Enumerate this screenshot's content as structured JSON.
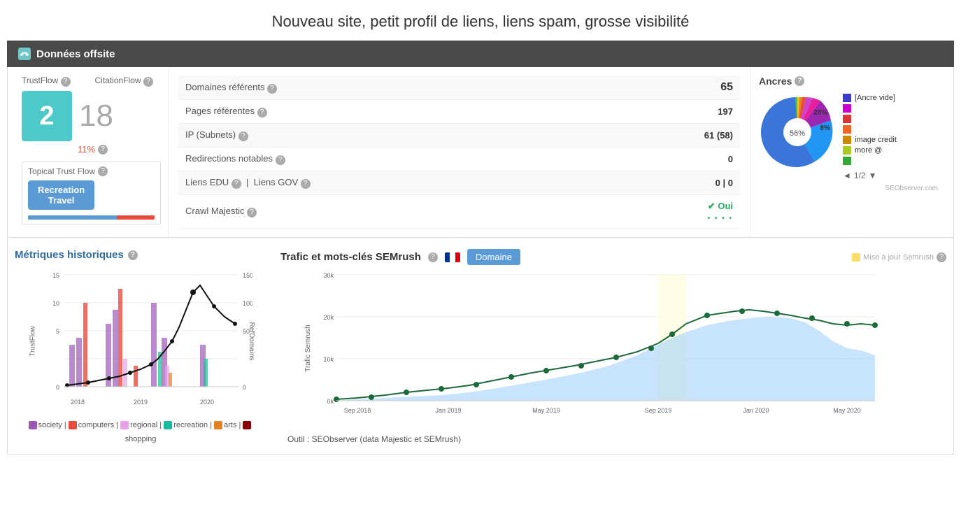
{
  "page": {
    "title": "Nouveau site, petit profil de liens, liens spam, grosse visibilité"
  },
  "section_header": {
    "label": "Données offsite"
  },
  "left_panel": {
    "trust_flow_label": "TrustFlow",
    "citation_flow_label": "CitationFlow",
    "trust_flow_value": "2",
    "citation_flow_value": "18",
    "percent_label": "11%",
    "topical_label": "Topical Trust Flow",
    "topical_badge": "Recreation\nTravel"
  },
  "metrics": {
    "rows": [
      {
        "label": "Domaines référents",
        "value": "65",
        "bold": true
      },
      {
        "label": "Pages référentes",
        "value": "197",
        "bold": false
      },
      {
        "label": "IP (Subnets)",
        "value": "61 (58)",
        "bold": false
      },
      {
        "label": "Redirections notables",
        "value": "0",
        "bold": false
      },
      {
        "label": "Liens EDU  |  Liens GOV",
        "value": "0  |  0",
        "bold": false
      },
      {
        "label": "Crawl Majestic",
        "value": "Oui",
        "bold": false,
        "green": true
      }
    ]
  },
  "anchors": {
    "title": "Ancres",
    "legend": [
      {
        "label": "[Ancre vide]",
        "color": "#3b3bcc"
      },
      {
        "label": "",
        "color": "#cc00cc"
      },
      {
        "label": "",
        "color": "#cc44cc"
      },
      {
        "label": "",
        "color": "#dd3333"
      },
      {
        "label": "",
        "color": "#ee6622"
      },
      {
        "label": "image credit",
        "color": "#bbaa33"
      },
      {
        "label": "more @",
        "color": "#aacc22"
      },
      {
        "label": "",
        "color": "#33aa33"
      }
    ],
    "pie_20": "20%",
    "pie_8": "8%",
    "pie_56": "56%",
    "nav": "◄ 1/2 ▼",
    "credit": "SEObserver.com"
  },
  "historique": {
    "title": "Métriques historiques",
    "chart_years": [
      "2018",
      "2019",
      "2020"
    ],
    "y_left_label": "TrustFlow",
    "y_right_label": "RefDomains",
    "y_left_ticks": [
      "0",
      "5",
      "10",
      "15"
    ],
    "y_right_ticks": [
      "0",
      "50",
      "100",
      "150"
    ],
    "legend_items": [
      {
        "label": "society",
        "color": "#9b59b6"
      },
      {
        "label": "computers",
        "color": "#e74c3c"
      },
      {
        "label": "regional",
        "color": "#e8a0e8"
      },
      {
        "label": "recreation",
        "color": "#1abc9c"
      },
      {
        "label": "arts",
        "color": "#e67e22"
      },
      {
        "label": "shopping",
        "color": "#8B0000"
      }
    ]
  },
  "semrush": {
    "title": "Trafic et mots-clés SEMrush",
    "domaine_btn": "Domaine",
    "mise_a_jour": "Mise à jour Semrush",
    "y_label": "Trafic Semrush",
    "y_ticks": [
      "0k",
      "10k",
      "20k",
      "30k"
    ],
    "x_ticks": [
      "Sep 2018",
      "Jan 2019",
      "May 2019",
      "Sep 2019",
      "Jan 2020",
      "May 2020"
    ],
    "outil_label": "Outil : SEObserver (data Majestic et SEMrush)"
  }
}
